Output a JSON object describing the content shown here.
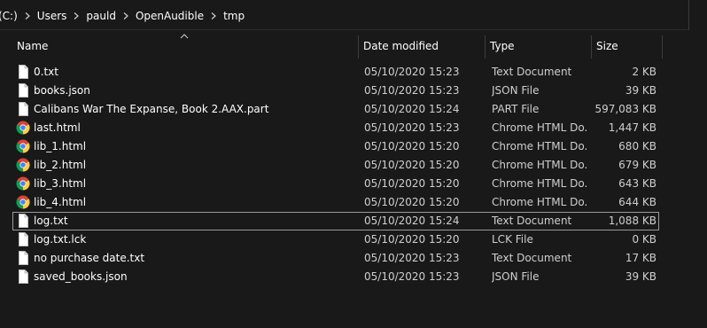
{
  "breadcrumb": {
    "items": [
      "(C:)",
      "Users",
      "pauld",
      "OpenAudible",
      "tmp"
    ]
  },
  "columns": {
    "name": "Name",
    "date": "Date modified",
    "type": "Type",
    "size": "Size"
  },
  "files": [
    {
      "name": "0.txt",
      "date": "05/10/2020 15:23",
      "type": "Text Document",
      "size": "2 KB",
      "icon": "document-icon"
    },
    {
      "name": "books.json",
      "date": "05/10/2020 15:23",
      "type": "JSON File",
      "size": "39 KB",
      "icon": "document-icon"
    },
    {
      "name": "Calibans War The Expanse, Book 2.AAX.part",
      "date": "05/10/2020 15:24",
      "type": "PART File",
      "size": "597,083 KB",
      "icon": "document-icon"
    },
    {
      "name": "last.html",
      "date": "05/10/2020 15:23",
      "type": "Chrome HTML Do...",
      "size": "1,447 KB",
      "icon": "chrome-icon"
    },
    {
      "name": "lib_1.html",
      "date": "05/10/2020 15:20",
      "type": "Chrome HTML Do...",
      "size": "680 KB",
      "icon": "chrome-icon"
    },
    {
      "name": "lib_2.html",
      "date": "05/10/2020 15:20",
      "type": "Chrome HTML Do...",
      "size": "679 KB",
      "icon": "chrome-icon"
    },
    {
      "name": "lib_3.html",
      "date": "05/10/2020 15:20",
      "type": "Chrome HTML Do...",
      "size": "643 KB",
      "icon": "chrome-icon"
    },
    {
      "name": "lib_4.html",
      "date": "05/10/2020 15:20",
      "type": "Chrome HTML Do...",
      "size": "644 KB",
      "icon": "chrome-icon"
    },
    {
      "name": "log.txt",
      "date": "05/10/2020 15:24",
      "type": "Text Document",
      "size": "1,088 KB",
      "icon": "document-icon",
      "selected": true
    },
    {
      "name": "log.txt.lck",
      "date": "05/10/2020 15:20",
      "type": "LCK File",
      "size": "0 KB",
      "icon": "document-icon"
    },
    {
      "name": "no purchase date.txt",
      "date": "05/10/2020 15:23",
      "type": "Text Document",
      "size": "17 KB",
      "icon": "document-icon"
    },
    {
      "name": "saved_books.json",
      "date": "05/10/2020 15:23",
      "type": "JSON File",
      "size": "39 KB",
      "icon": "document-icon"
    }
  ],
  "colors": {
    "background": "#191919",
    "text": "#ffffff",
    "secondary_text": "#cfcfcf",
    "selection_border": "#9a9a9a"
  }
}
